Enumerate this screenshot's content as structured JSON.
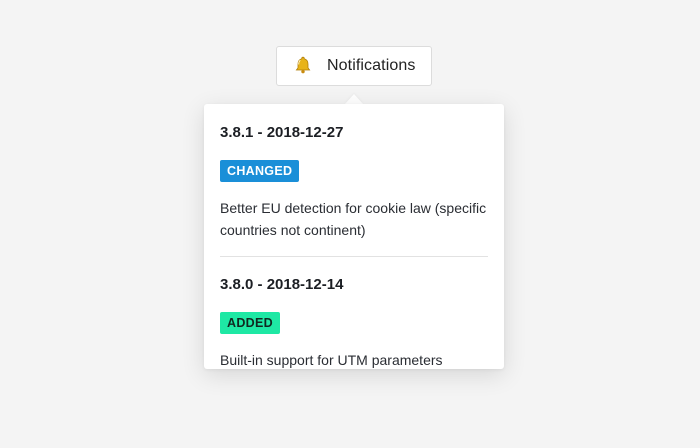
{
  "notifications_button": {
    "label": "Notifications",
    "icon": "bell-icon"
  },
  "entries": [
    {
      "version": "3.8.1 - 2018-12-27",
      "badge": "CHANGED",
      "badge_color": "#1a8fd8",
      "description": "Better EU detection for cookie law (specific countries not continent)"
    },
    {
      "version": "3.8.0 - 2018-12-14",
      "badge": "ADDED",
      "badge_color": "#1ee8a4",
      "description": "Built-in support for UTM parameters"
    }
  ]
}
